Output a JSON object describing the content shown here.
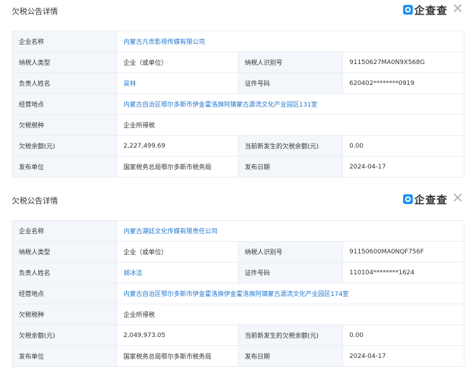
{
  "brand_name": "企查查",
  "panels": [
    {
      "title": "欠税公告详情",
      "labels": {
        "company": "企业名称",
        "taxpayer_type": "纳税人类型",
        "taxpayer_id": "纳税人识别号",
        "person": "负责人姓名",
        "cert_no": "证件号码",
        "address": "经营地点",
        "tax_type": "欠税税种",
        "balance": "欠税余额(元)",
        "new_balance": "当前新发生的欠税余额(元)",
        "publisher": "发布单位",
        "date": "发布日期"
      },
      "values": {
        "company": "内蒙古凡世影视传媒有限公司",
        "taxpayer_type": "企业（或单位）",
        "taxpayer_id": "91150627MA0N9X568G",
        "person": "吴林",
        "cert_no": "620402********0919",
        "address": "内蒙古自治区鄂尔多斯市伊金霍洛旗阿镇蒙古源流文化产业园区131室",
        "tax_type": "企业所得税",
        "balance": "2,227,499.69",
        "new_balance": "0.00",
        "publisher": "国家税务总局鄂尔多斯市税务局",
        "date": "2024-04-17"
      }
    },
    {
      "title": "欠税公告详情",
      "labels": {
        "company": "企业名称",
        "taxpayer_type": "纳税人类型",
        "taxpayer_id": "纳税人识别号",
        "person": "负责人姓名",
        "cert_no": "证件号码",
        "address": "经营地点",
        "tax_type": "欠税税种",
        "balance": "欠税余额(元)",
        "new_balance": "当前新发生的欠税余额(元)",
        "publisher": "发布单位",
        "date": "发布日期"
      },
      "values": {
        "company": "内蒙古潮廷文化传媒有限责任公司",
        "taxpayer_type": "企业（或单位）",
        "taxpayer_id": "91150600MA0NQF756F",
        "person": "胡冰洁",
        "cert_no": "110104********1624",
        "address": "内蒙古自治区鄂尔多斯市伊金霍洛旗伊金霍洛旗阿镇蒙古源流文化产业园区174室",
        "tax_type": "企业所得税",
        "balance": "2,049,973.05",
        "new_balance": "0.00",
        "publisher": "国家税务总局鄂尔多斯市税务局",
        "date": "2024-04-17"
      }
    }
  ]
}
